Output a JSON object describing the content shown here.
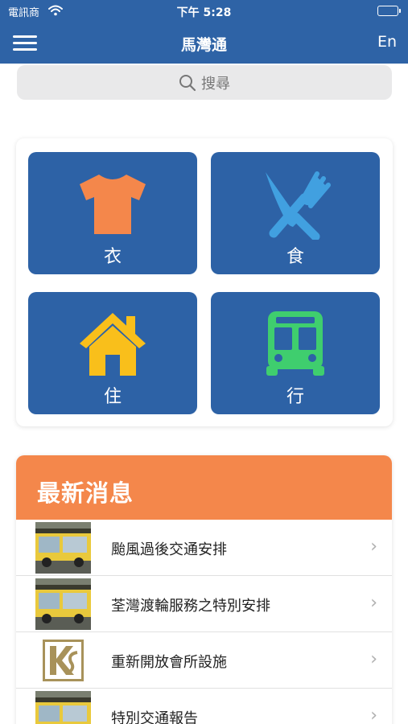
{
  "status_bar": {
    "carrier": "電訊商",
    "time": "下午 5:28"
  },
  "nav": {
    "title": "馬灣通",
    "language_toggle": "En"
  },
  "search": {
    "placeholder": "搜尋"
  },
  "categories": [
    {
      "label": "衣",
      "icon": "shirt-icon",
      "color": "#f4874b"
    },
    {
      "label": "食",
      "icon": "cutlery-icon",
      "color": "#41a0e0"
    },
    {
      "label": "住",
      "icon": "house-icon",
      "color": "#f9bf1b"
    },
    {
      "label": "行",
      "icon": "bus-icon",
      "color": "#3fce6e"
    }
  ],
  "news": {
    "header": "最新消息",
    "items": [
      {
        "title": "颱風過後交通安排",
        "thumb": "bus-photo"
      },
      {
        "title": "荃灣渡輪服務之特別安排",
        "thumb": "bus-photo"
      },
      {
        "title": "重新開放會所設施",
        "thumb": "ks-logo"
      },
      {
        "title": "特別交通報告",
        "thumb": "bus-photo"
      }
    ]
  },
  "colors": {
    "brand_blue": "#2e63a6",
    "tile_blue": "#2d62a6",
    "news_orange": "#f4874b"
  }
}
